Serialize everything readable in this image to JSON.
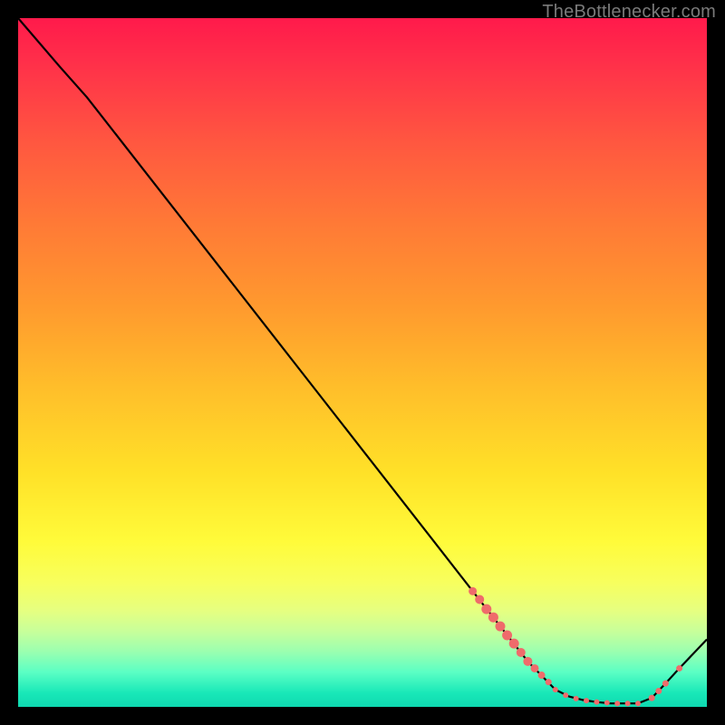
{
  "watermark": "TheBottlenecker.com",
  "colors": {
    "page_bg": "#000000",
    "curve_stroke": "#000000",
    "marker_fill": "#ef6b6b",
    "marker_stroke": "#ef6b6b"
  },
  "chart_data": {
    "type": "line",
    "title": "",
    "xlabel": "",
    "ylabel": "",
    "xlim": [
      0,
      100
    ],
    "ylim": [
      0,
      100
    ],
    "grid": false,
    "legend": false,
    "series": [
      {
        "name": "bottleneck-curve",
        "x": [
          0,
          6,
          10,
          20,
          30,
          40,
          50,
          60,
          66,
          70,
          74,
          78,
          80,
          82,
          84,
          86,
          88,
          90,
          92,
          94,
          96,
          100
        ],
        "y": [
          100,
          93,
          88.5,
          75.7,
          62.9,
          50.1,
          37.3,
          24.5,
          16.8,
          11.7,
          6.6,
          2.5,
          1.5,
          1.0,
          0.7,
          0.5,
          0.5,
          0.5,
          1.3,
          3.4,
          5.6,
          9.8
        ]
      }
    ],
    "markers": [
      {
        "x": 66.0,
        "y": 16.8,
        "r": 4.5
      },
      {
        "x": 67.0,
        "y": 15.6,
        "r": 5.0
      },
      {
        "x": 68.0,
        "y": 14.2,
        "r": 5.5
      },
      {
        "x": 69.0,
        "y": 13.0,
        "r": 5.5
      },
      {
        "x": 70.0,
        "y": 11.7,
        "r": 5.5
      },
      {
        "x": 71.0,
        "y": 10.4,
        "r": 5.5
      },
      {
        "x": 72.0,
        "y": 9.2,
        "r": 5.5
      },
      {
        "x": 73.0,
        "y": 7.9,
        "r": 5.0
      },
      {
        "x": 74.0,
        "y": 6.6,
        "r": 5.0
      },
      {
        "x": 75.0,
        "y": 5.6,
        "r": 4.5
      },
      {
        "x": 76.0,
        "y": 4.6,
        "r": 4.0
      },
      {
        "x": 77.0,
        "y": 3.6,
        "r": 3.5
      },
      {
        "x": 78.0,
        "y": 2.5,
        "r": 3.0
      },
      {
        "x": 79.5,
        "y": 1.7,
        "r": 3.0
      },
      {
        "x": 81.0,
        "y": 1.2,
        "r": 3.0
      },
      {
        "x": 82.5,
        "y": 0.9,
        "r": 3.0
      },
      {
        "x": 84.0,
        "y": 0.7,
        "r": 3.0
      },
      {
        "x": 85.5,
        "y": 0.6,
        "r": 3.0
      },
      {
        "x": 87.0,
        "y": 0.5,
        "r": 3.0
      },
      {
        "x": 88.5,
        "y": 0.5,
        "r": 3.0
      },
      {
        "x": 90.0,
        "y": 0.5,
        "r": 3.0
      },
      {
        "x": 92.0,
        "y": 1.3,
        "r": 3.5
      },
      {
        "x": 93.0,
        "y": 2.3,
        "r": 3.5
      },
      {
        "x": 94.0,
        "y": 3.4,
        "r": 3.5
      },
      {
        "x": 96.0,
        "y": 5.6,
        "r": 3.5
      }
    ]
  }
}
